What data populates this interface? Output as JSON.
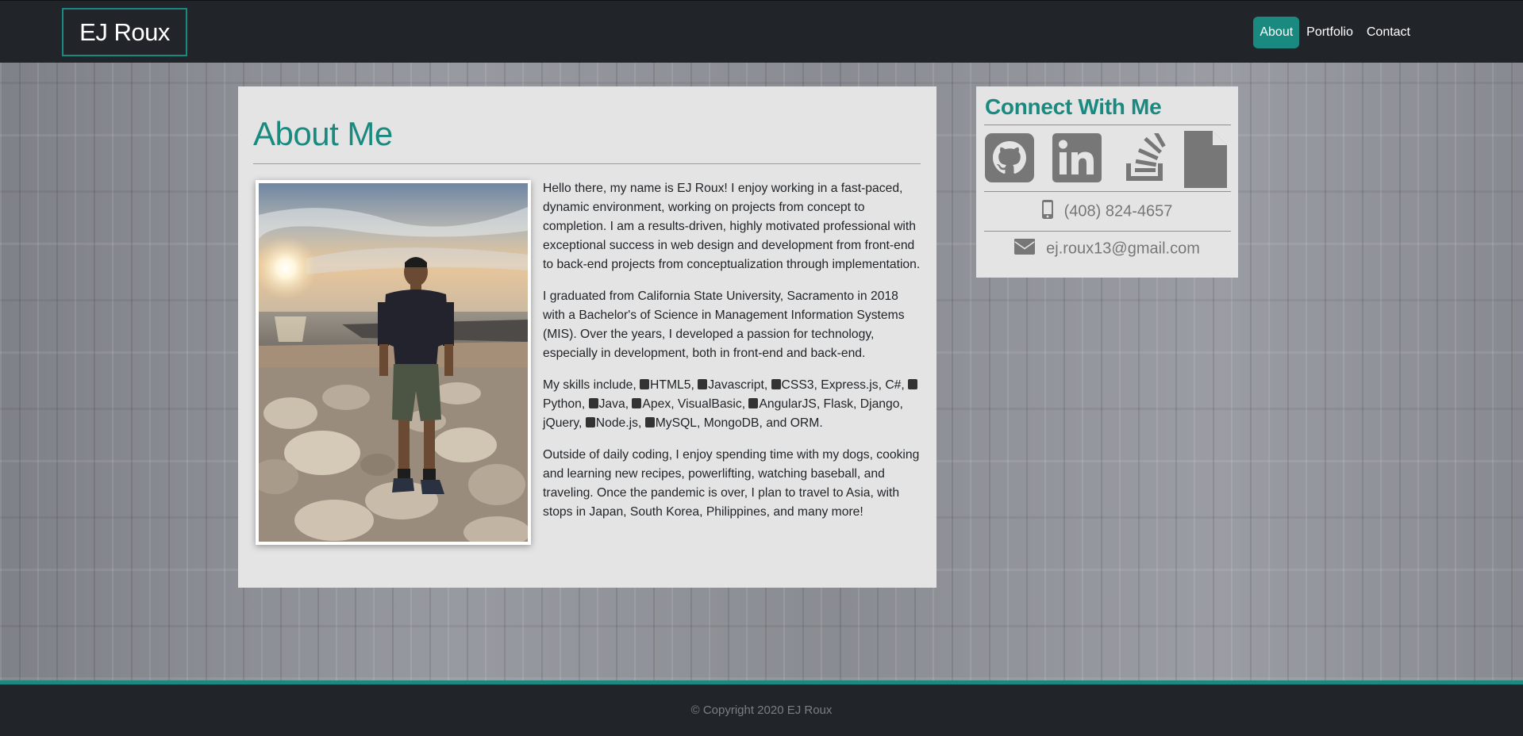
{
  "brand": {
    "name": "EJ Roux"
  },
  "nav": {
    "items": [
      {
        "label": "About",
        "active": true
      },
      {
        "label": "Portfolio",
        "active": false
      },
      {
        "label": "Contact",
        "active": false
      }
    ]
  },
  "about": {
    "title": "About Me",
    "paragraphs": [
      "Hello there, my name is EJ Roux! I enjoy working in a fast-paced, dynamic environment, working on projects from concept to completion. I am a results-driven, highly motivated professional with exceptional success in web design and development from front-end to back-end projects from conceptualization through implementation.",
      "I graduated from California State University, Sacramento in 2018 with a Bachelor's of Science in Management Information Systems (MIS). Over the years, I developed a passion for technology, especially in development, both in front-end and back-end.",
      "Outside of daily coding, I enjoy spending time with my dogs, cooking and learning new recipes, powerlifting, watching baseball, and traveling. Once the pandemic is over, I plan to travel to Asia, with stops in Japan, South Korea, Philippines, and many more!"
    ],
    "skills_intro": "My skills include, ",
    "skills": [
      {
        "name": "HTML5",
        "icon": "html5-icon",
        "sep": ", "
      },
      {
        "name": "Javascript",
        "icon": "javascript-icon",
        "sep": ", "
      },
      {
        "name": "CSS3",
        "icon": "css3-icon",
        "sep": ", "
      },
      {
        "name": "Express.js",
        "icon": "",
        "sep": ", "
      },
      {
        "name": "C#",
        "icon": "",
        "sep": ", "
      },
      {
        "name": "Python",
        "icon": "python-icon",
        "sep": ", "
      },
      {
        "name": "Java",
        "icon": "java-icon",
        "sep": ", "
      },
      {
        "name": "Apex",
        "icon": "salesforce-icon",
        "sep": ", "
      },
      {
        "name": "VisualBasic",
        "icon": "",
        "sep": ", "
      },
      {
        "name": "AngularJS",
        "icon": "angular-icon",
        "sep": ", "
      },
      {
        "name": "Flask",
        "icon": "",
        "sep": ", "
      },
      {
        "name": "Django",
        "icon": "",
        "sep": ", "
      },
      {
        "name": "jQuery",
        "icon": "",
        "sep": ", "
      },
      {
        "name": "Node.js",
        "icon": "nodejs-icon",
        "sep": ", "
      },
      {
        "name": "MySQL",
        "icon": "database-icon",
        "sep": ", "
      },
      {
        "name": "MongoDB",
        "icon": "",
        "sep": ", and "
      },
      {
        "name": "ORM",
        "icon": "",
        "sep": "."
      }
    ]
  },
  "connect": {
    "title": "Connect With Me",
    "social_icons": [
      "github-icon",
      "linkedin-icon",
      "stackoverflow-icon",
      "resume-file-icon"
    ],
    "phone": "(408) 824-4657",
    "email": "ej.roux13@gmail.com"
  },
  "footer": {
    "copyright": "© Copyright 2020 EJ Roux"
  },
  "colors": {
    "accent": "#1a8a80",
    "nav_bg": "#212529",
    "card_bg": "#e4e4e4",
    "icon_gray": "#777777"
  }
}
